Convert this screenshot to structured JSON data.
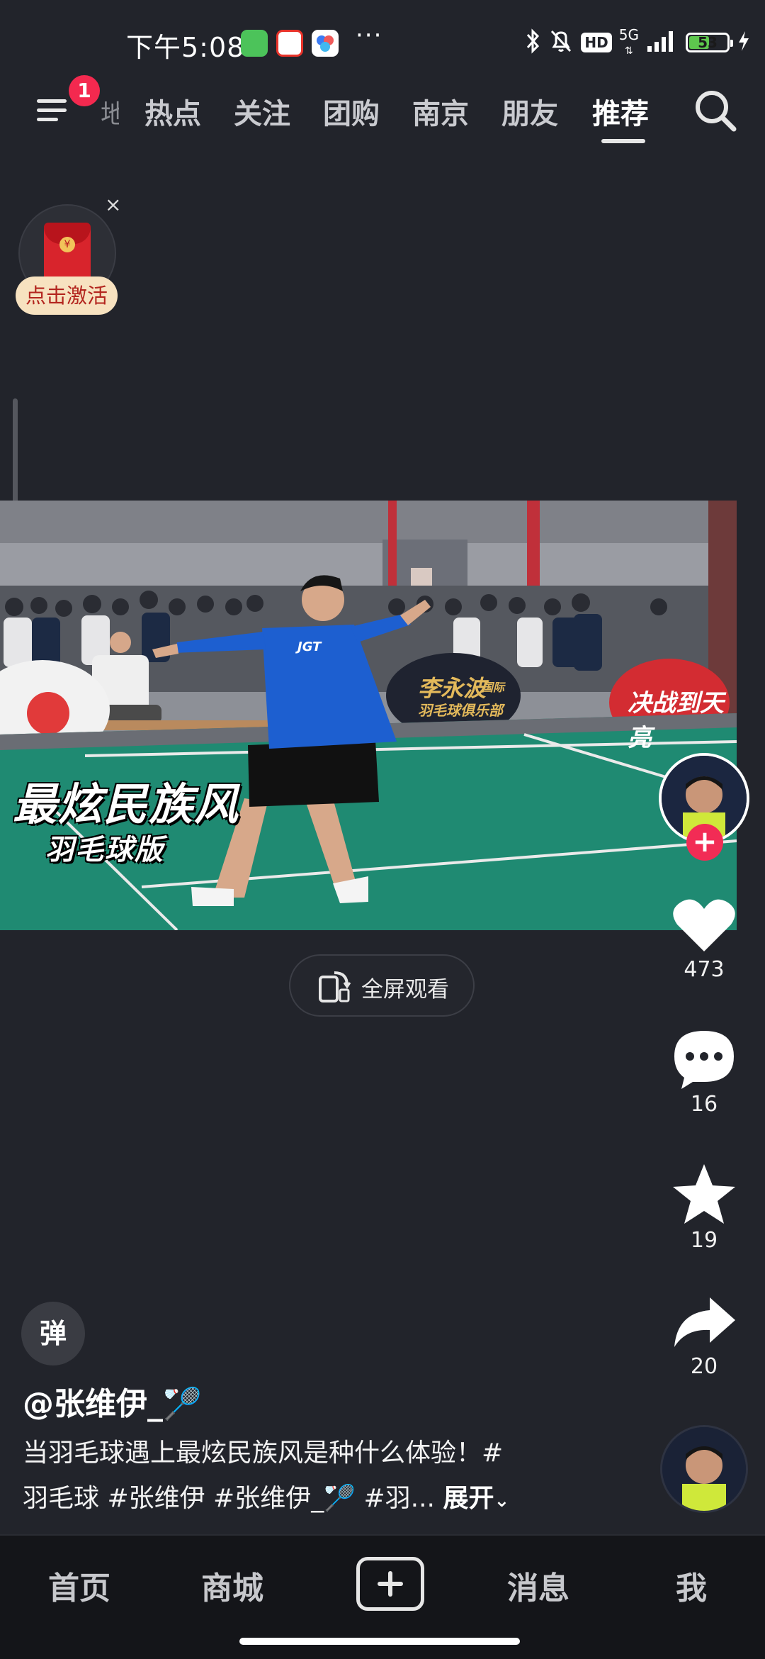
{
  "status_bar": {
    "time": "下午5:08",
    "more": "···",
    "hd": "HD",
    "network": "5G",
    "battery": "53",
    "battery_level": 0.53
  },
  "top_nav": {
    "notification_count": "1",
    "partial_tab": "地",
    "tabs": [
      "热点",
      "关注",
      "团购",
      "南京",
      "朋友",
      "推荐"
    ],
    "active_tab": "推荐"
  },
  "promo": {
    "close": "×",
    "activate_label": "点击激活",
    "coin_symbol": "¥"
  },
  "video": {
    "caption_main": "最炫民族风",
    "caption_sub": "羽毛球版",
    "sponsor_left": "李永波",
    "sponsor_left_tag": "国际",
    "sponsor_left_sub": "羽毛球俱乐部",
    "sponsor_right": "决战到天亮",
    "shirt_text": "JGT"
  },
  "fullscreen": {
    "label": "全屏观看"
  },
  "actions": {
    "follow_symbol": "+",
    "likes": "473",
    "comments": "16",
    "favorites": "19",
    "shares": "20"
  },
  "post": {
    "danmu_label": "弹",
    "author": "@张维伊_🏸",
    "desc_line1": "当羽毛球遇上最炫民族风是种什么体验！#",
    "desc_line2": "羽毛球 #张维伊 #张维伊_🏸 #羽...",
    "expand_label": "展开"
  },
  "bottom_nav": {
    "items": [
      "首页",
      "商城",
      "消息",
      "我"
    ]
  },
  "colors": {
    "background": "#22242b",
    "accent_red": "#f22c55",
    "court_green": "#1f8a72",
    "jersey_blue": "#1d5fd0"
  }
}
